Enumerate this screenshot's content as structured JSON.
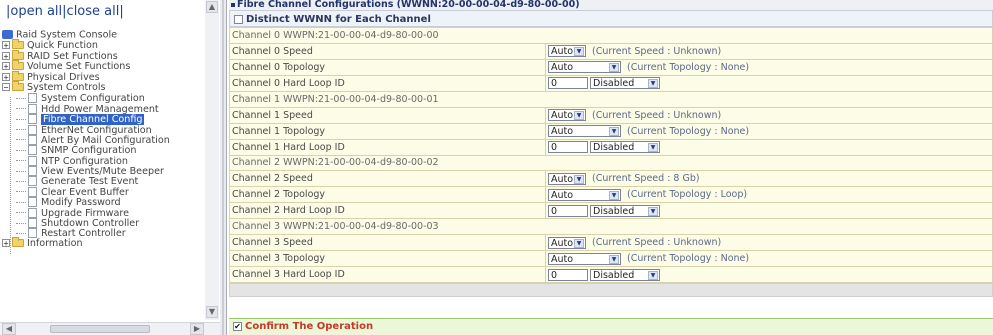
{
  "tree_header": {
    "open_all": "open all",
    "separator": "|",
    "close_all": "close all",
    "bar_left": "|",
    "bar_right": "|"
  },
  "tree": {
    "root": "Raid System Console",
    "folders": [
      {
        "label": "Quick Function",
        "expanded": false
      },
      {
        "label": "RAID Set Functions",
        "expanded": false
      },
      {
        "label": "Volume Set Functions",
        "expanded": false
      },
      {
        "label": "Physical Drives",
        "expanded": false
      },
      {
        "label": "System Controls",
        "expanded": true
      }
    ],
    "system_controls_children": [
      "System Configuration",
      "Hdd Power Management",
      "Fibre Channel Config",
      "EtherNet Configuration",
      "Alert By Mail Configuration",
      "SNMP Configuration",
      "NTP Configuration",
      "View Events/Mute Beeper",
      "Generate Test Event",
      "Clear Event Buffer",
      "Modify Password",
      "Upgrade Firmware",
      "Shutdown Controller",
      "Restart Controller"
    ],
    "selected": "Fibre Channel Config",
    "last_folder": "Information"
  },
  "panel": {
    "title": "Fibre Channel Configurations (WWNN:20-00-00-04-d9-80-00-00)",
    "distinct_label": "Distinct WWNN for Each Channel",
    "distinct_checked": false,
    "confirm_label": "Confirm The Operation",
    "confirm_checked": true
  },
  "channels": [
    {
      "wwpn": "Channel 0 WWPN:21-00-00-04-d9-80-00-00",
      "speed_label": "Channel 0 Speed",
      "speed_value": "Auto",
      "speed_note": "(Current Speed : Unknown)",
      "topo_label": "Channel 0 Topology",
      "topo_value": "Auto",
      "topo_note": "(Current Topology : None)",
      "loop_label": "Channel 0 Hard Loop ID",
      "loop_id": "0",
      "loop_state": "Disabled"
    },
    {
      "wwpn": "Channel 1 WWPN:21-00-00-04-d9-80-00-01",
      "speed_label": "Channel 1 Speed",
      "speed_value": "Auto",
      "speed_note": "(Current Speed : Unknown)",
      "topo_label": "Channel 1 Topology",
      "topo_value": "Auto",
      "topo_note": "(Current Topology : None)",
      "loop_label": "Channel 1 Hard Loop ID",
      "loop_id": "0",
      "loop_state": "Disabled"
    },
    {
      "wwpn": "Channel 2 WWPN:21-00-00-04-d9-80-00-02",
      "speed_label": "Channel 2 Speed",
      "speed_value": "Auto",
      "speed_note": "(Current Speed : 8 Gb)",
      "topo_label": "Channel 2 Topology",
      "topo_value": "Auto",
      "topo_note": "(Current Topology : Loop)",
      "loop_label": "Channel 2 Hard Loop ID",
      "loop_id": "0",
      "loop_state": "Disabled"
    },
    {
      "wwpn": "Channel 3 WWPN:21-00-00-04-d9-80-00-03",
      "speed_label": "Channel 3 Speed",
      "speed_value": "Auto",
      "speed_note": "(Current Speed : Unknown)",
      "topo_label": "Channel 3 Topology",
      "topo_value": "Auto",
      "topo_note": "(Current Topology : None)",
      "loop_label": "Channel 3 Hard Loop ID",
      "loop_id": "0",
      "loop_state": "Disabled"
    }
  ],
  "icons": {
    "dropdown": "chevron-down-icon",
    "checkbox_check": "✔"
  }
}
